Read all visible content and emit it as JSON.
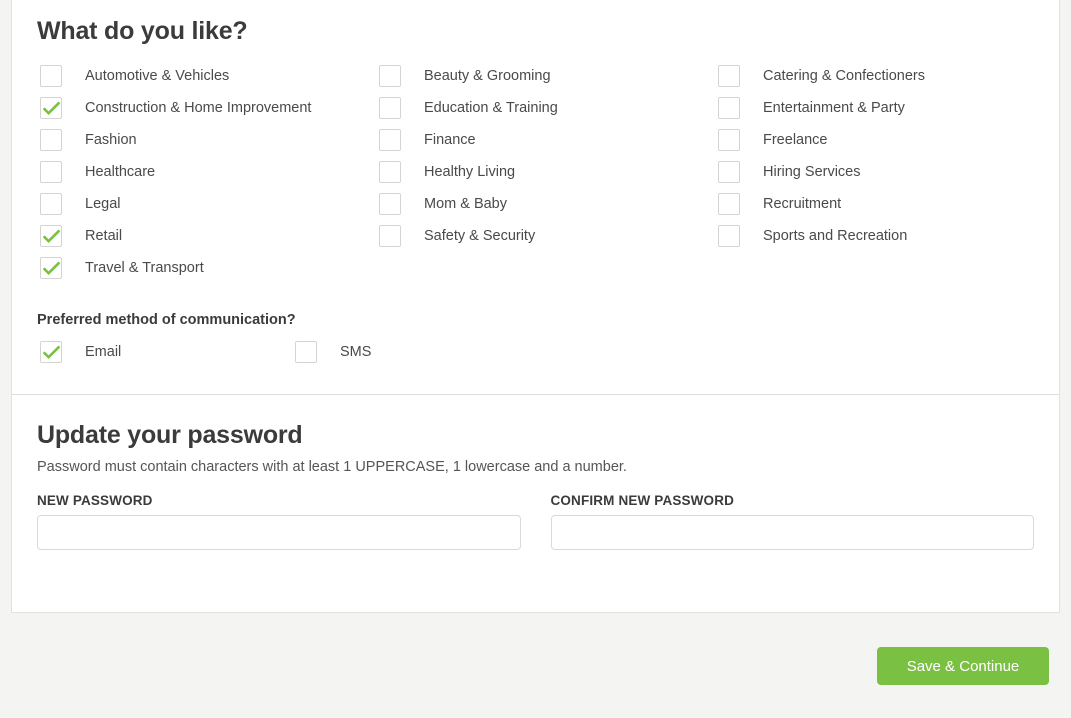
{
  "preferences": {
    "heading": "What do you like?",
    "columns": [
      [
        {
          "label": "Automotive & Vehicles",
          "checked": false
        },
        {
          "label": "Construction & Home Improvement",
          "checked": true
        },
        {
          "label": "Fashion",
          "checked": false
        },
        {
          "label": "Healthcare",
          "checked": false
        },
        {
          "label": "Legal",
          "checked": false
        },
        {
          "label": "Retail",
          "checked": true
        },
        {
          "label": "Travel & Transport",
          "checked": true
        }
      ],
      [
        {
          "label": "Beauty & Grooming",
          "checked": false
        },
        {
          "label": "Education & Training",
          "checked": false
        },
        {
          "label": "Finance",
          "checked": false
        },
        {
          "label": "Healthy Living",
          "checked": false
        },
        {
          "label": "Mom & Baby",
          "checked": false
        },
        {
          "label": "Safety & Security",
          "checked": false
        }
      ],
      [
        {
          "label": "Catering & Confectioners",
          "checked": false
        },
        {
          "label": "Entertainment & Party",
          "checked": false
        },
        {
          "label": "Freelance",
          "checked": false
        },
        {
          "label": "Hiring Services",
          "checked": false
        },
        {
          "label": "Recruitment",
          "checked": false
        },
        {
          "label": "Sports and Recreation",
          "checked": false
        }
      ]
    ]
  },
  "communication": {
    "label": "Preferred method of communication?",
    "options": [
      {
        "label": "Email",
        "checked": true
      },
      {
        "label": "SMS",
        "checked": false
      }
    ]
  },
  "password": {
    "heading": "Update your password",
    "help": "Password must contain characters with at least 1 UPPERCASE, 1 lowercase and a number.",
    "new_label": "NEW PASSWORD",
    "new_value": "",
    "confirm_label": "CONFIRM NEW PASSWORD",
    "confirm_value": ""
  },
  "footer": {
    "save_label": "Save & Continue"
  },
  "colors": {
    "accent": "#7ac143",
    "check": "#7ac143",
    "page_bg": "#f4f4f2",
    "card_bg": "#ffffff",
    "border": "#d9d9d7",
    "text": "#4a4a48"
  }
}
